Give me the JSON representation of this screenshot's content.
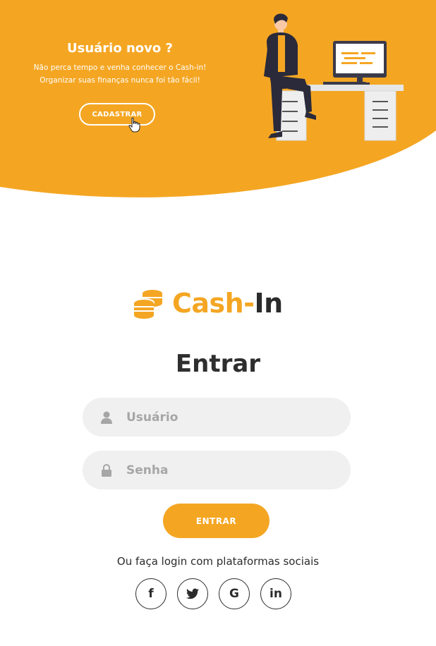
{
  "hero": {
    "title": "Usuário novo ?",
    "description": "Não perca tempo e venha conhecer o Cash-in! Organizar suas finanças nunca foi tão fácil!",
    "signup_label": "CADASTRAR"
  },
  "logo": {
    "part1": "Cash-",
    "part2": "In"
  },
  "form": {
    "title": "Entrar",
    "username_placeholder": "Usuário",
    "username_value": "",
    "password_placeholder": "Senha",
    "password_value": "",
    "submit_label": "ENTRAR"
  },
  "social": {
    "text": "Ou faça login com plataformas sociais",
    "items": [
      {
        "icon": "facebook-icon",
        "glyph": "f"
      },
      {
        "icon": "twitter-icon",
        "glyph": ""
      },
      {
        "icon": "google-icon",
        "glyph": "G"
      },
      {
        "icon": "linkedin-icon",
        "glyph": "in"
      }
    ]
  },
  "colors": {
    "accent": "#f4a623",
    "dark": "#2b2b2b",
    "field_bg": "#eff0ef"
  }
}
